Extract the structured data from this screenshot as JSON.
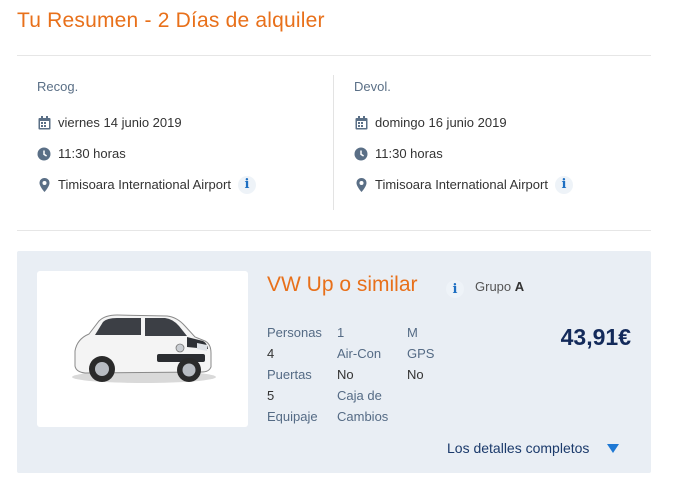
{
  "summary": {
    "title": "Tu Resumen - 2 Días de alquiler"
  },
  "pickup": {
    "heading": "Recog.",
    "date": "viernes 14 junio 2019",
    "time": "11:30 horas",
    "location": "Timisoara International Airport"
  },
  "return": {
    "heading": "Devol.",
    "date": "domingo 16 junio 2019",
    "time": "11:30 horas",
    "location": "Timisoara International Airport"
  },
  "info_glyph": "i",
  "car": {
    "name": "VW Up o similar",
    "group_label": "Grupo",
    "group_value": "A",
    "price": "43,91€",
    "details_label": "Los detalles completos",
    "specs": {
      "col1": [
        {
          "text": "Personas",
          "kind": "label"
        },
        {
          "text": "4",
          "kind": "val"
        },
        {
          "text": "Puertas",
          "kind": "label"
        },
        {
          "text": "5",
          "kind": "val"
        },
        {
          "text": "Equipaje",
          "kind": "label"
        }
      ],
      "col2": [
        {
          "text": "1",
          "kind": "val"
        },
        {
          "text": "Air-Con",
          "kind": "label"
        },
        {
          "text": "No",
          "kind": "val"
        },
        {
          "text": "Caja de",
          "kind": "label"
        },
        {
          "text": "Cambios",
          "kind": "label"
        }
      ],
      "col3": [
        {
          "text": "M",
          "kind": "val"
        },
        {
          "text": "GPS",
          "kind": "label"
        },
        {
          "text": "No",
          "kind": "val"
        }
      ]
    }
  },
  "colors": {
    "accent": "#e8701a",
    "label_blue": "#556b85",
    "price_navy": "#132a5a",
    "link_blue": "#1e78d4",
    "card_bg": "#e9eef4"
  },
  "icons": {
    "date": "calendar-icon",
    "time": "clock-icon",
    "location": "location-pin-icon",
    "info": "info-icon",
    "expand": "triangle-down-icon"
  }
}
